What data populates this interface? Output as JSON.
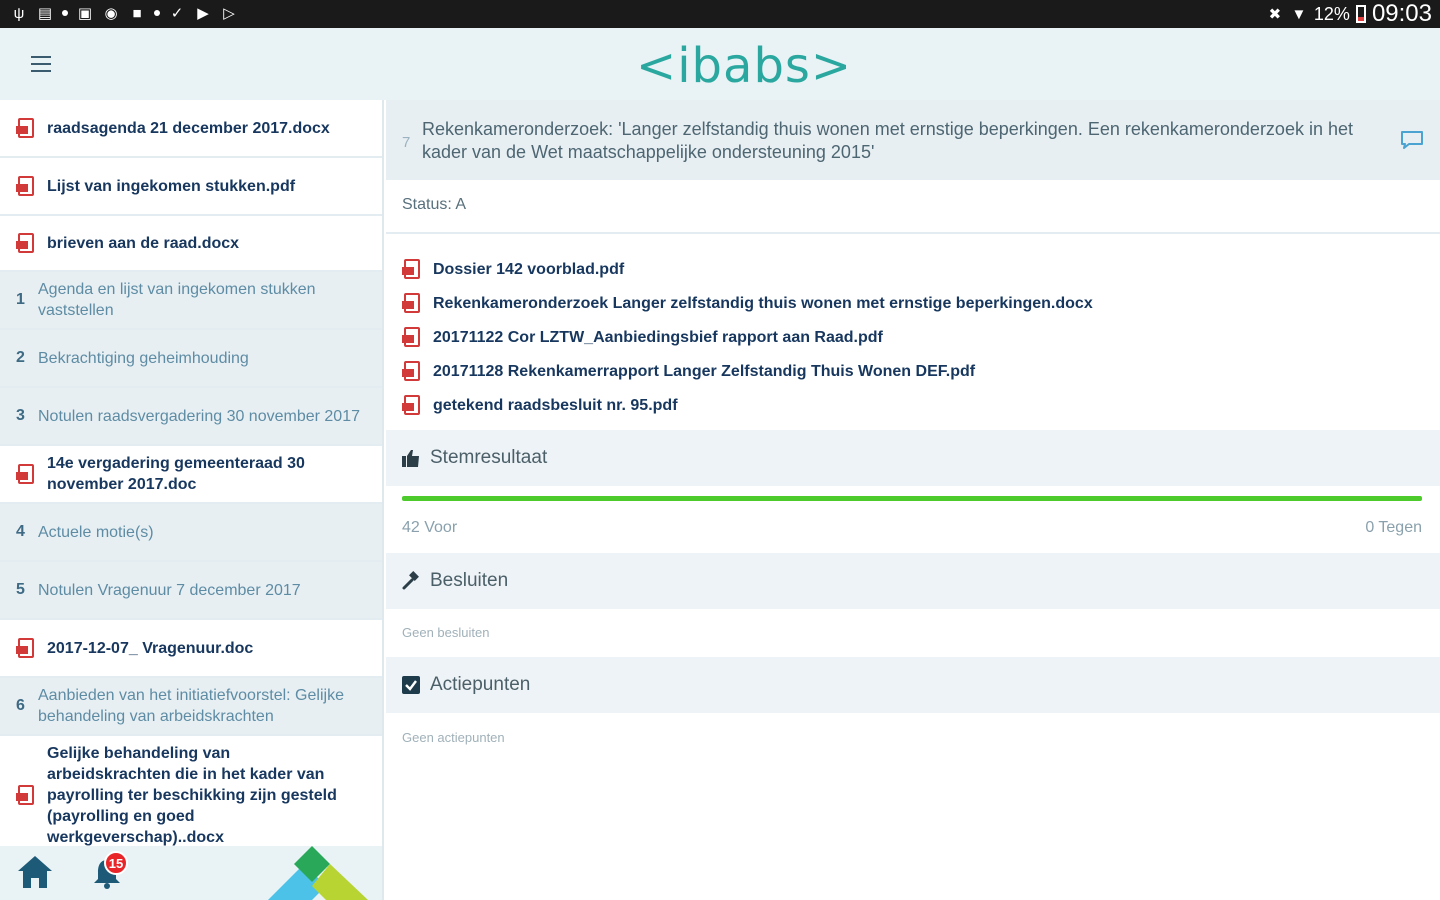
{
  "statusbar": {
    "battery": "12%",
    "time": "09:03"
  },
  "header": {
    "logo": "ibabs",
    "logo_open": "<",
    "logo_close": ">"
  },
  "sidebar": {
    "items": [
      {
        "kind": "doc",
        "label": "raadsagenda 21 december 2017.docx"
      },
      {
        "kind": "doc",
        "label": "Lijst van ingekomen stukken.pdf"
      },
      {
        "kind": "doc",
        "label": "brieven aan de raad.docx"
      },
      {
        "kind": "agenda",
        "num": "1",
        "label": "Agenda en lijst van ingekomen stukken vaststellen"
      },
      {
        "kind": "agenda",
        "num": "2",
        "label": "Bekrachtiging geheimhouding"
      },
      {
        "kind": "agenda",
        "num": "3",
        "label": "Notulen raadsvergadering 30 november 2017"
      },
      {
        "kind": "doc",
        "label": "14e vergadering gemeenteraad 30 november 2017.doc"
      },
      {
        "kind": "agenda",
        "num": "4",
        "label": "Actuele motie(s)"
      },
      {
        "kind": "agenda",
        "num": "5",
        "label": "Notulen Vragenuur 7 december 2017"
      },
      {
        "kind": "doc",
        "label": "2017-12-07_ Vragenuur.doc"
      },
      {
        "kind": "agenda",
        "num": "6",
        "label": "Aanbieden van het initiatiefvoorstel: Gelijke behandeling van arbeidskrachten"
      },
      {
        "kind": "doc",
        "label": "Gelijke behandeling van arbeidskrachten die in het kader van payrolling ter beschikking zijn gesteld (payrolling en goed werkgeverschap)..docx"
      }
    ]
  },
  "footer": {
    "notification_count": "15"
  },
  "main": {
    "item_number": "7",
    "title": "Rekenkameronderzoek: 'Langer zelfstandig thuis wonen met ernstige beperkingen. Een rekenkameronderzoek in het kader van de Wet maatschappelijke ondersteuning 2015'",
    "status": "Status: A",
    "files": [
      "Dossier 142 voorblad.pdf",
      "Rekenkameronderzoek Langer zelfstandig thuis wonen met ernstige beperkingen.docx",
      "20171122 Cor LZTW_Aanbiedingsbief rapport aan Raad.pdf",
      "20171128 Rekenkamerrapport Langer Zelfstandig Thuis Wonen DEF.pdf",
      "getekend raadsbesluit nr. 95.pdf"
    ],
    "vote": {
      "heading": "Stemresultaat",
      "for_label": "42 Voor",
      "against_label": "0 Tegen",
      "for_fraction": 1.0
    },
    "decisions": {
      "heading": "Besluiten",
      "empty": "Geen besluiten"
    },
    "actions": {
      "heading": "Actiepunten",
      "empty": "Geen actiepunten"
    }
  },
  "colors": {
    "accent": "#2aa8a0",
    "vote_green": "#4ecb2c",
    "doc_red": "#d23a3a",
    "dark_blue": "#17375e",
    "badge_red": "#e8262a"
  }
}
